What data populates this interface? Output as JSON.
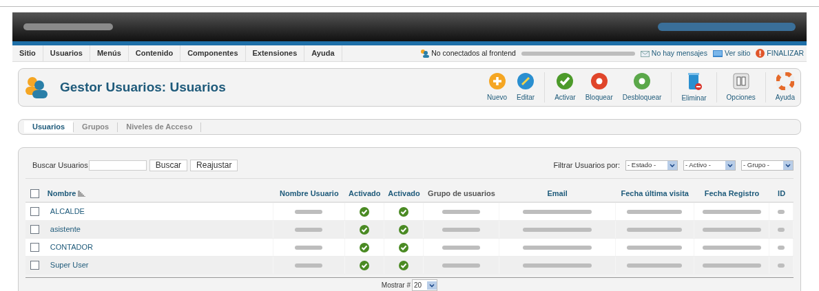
{
  "menu": [
    {
      "label": "Sitio"
    },
    {
      "label": "Usuarios"
    },
    {
      "label": "Menús"
    },
    {
      "label": "Contenido"
    },
    {
      "label": "Componentes"
    },
    {
      "label": "Extensiones"
    },
    {
      "label": "Ayuda"
    }
  ],
  "status": [
    {
      "kind": "users",
      "label": "No conectados al frontend"
    },
    {
      "kind": "blurred"
    },
    {
      "kind": "mail",
      "label": "No hay mensajes"
    },
    {
      "kind": "screen",
      "label": "Ver sitio"
    },
    {
      "kind": "logout",
      "label": "FINALIZAR"
    }
  ],
  "title": "Gestor Usuarios: Usuarios",
  "toolbar": [
    {
      "kind": "new",
      "label": "Nuevo"
    },
    {
      "kind": "edit",
      "label": "Editar"
    },
    {
      "kind": "divider"
    },
    {
      "kind": "activate",
      "label": "Activar"
    },
    {
      "kind": "block",
      "label": "Bloquear"
    },
    {
      "kind": "unblock",
      "label": "Desbloquear"
    },
    {
      "kind": "divider"
    },
    {
      "kind": "delete",
      "label": "Eliminar"
    },
    {
      "kind": "divider"
    },
    {
      "kind": "options",
      "label": "Opciones"
    },
    {
      "kind": "divider"
    },
    {
      "kind": "help",
      "label": "Ayuda"
    }
  ],
  "tabs": [
    {
      "label": "Usuarios",
      "selected": true
    },
    {
      "label": "Grupos",
      "selected": false
    },
    {
      "label": "Niveles de Acceso",
      "selected": false
    }
  ],
  "search": {
    "label": "Buscar Usuarios",
    "buttons": [
      "Buscar",
      "Reajustar"
    ]
  },
  "filter": {
    "label": "Filtrar Usuarios por:",
    "selects": [
      "- Estado -",
      "- Activo -",
      "- Grupo -"
    ]
  },
  "table": {
    "all_checked": false,
    "columns": [
      "Nombre",
      "Nombre Usuario",
      "Activado",
      "Activado",
      "Grupo de usuarios",
      "Email",
      "Fecha última visita",
      "Fecha Registro",
      "ID"
    ],
    "rows": [
      {
        "name": "ALCALDE",
        "checked": false,
        "activated": true,
        "enabled": true
      },
      {
        "name": "asistente",
        "checked": false,
        "activated": true,
        "enabled": true
      },
      {
        "name": "CONTADOR",
        "checked": false,
        "activated": true,
        "enabled": true
      },
      {
        "name": "Super User",
        "checked": false,
        "activated": true,
        "enabled": true
      }
    ]
  },
  "pagination": {
    "label": "Mostrar #",
    "value": "20"
  }
}
